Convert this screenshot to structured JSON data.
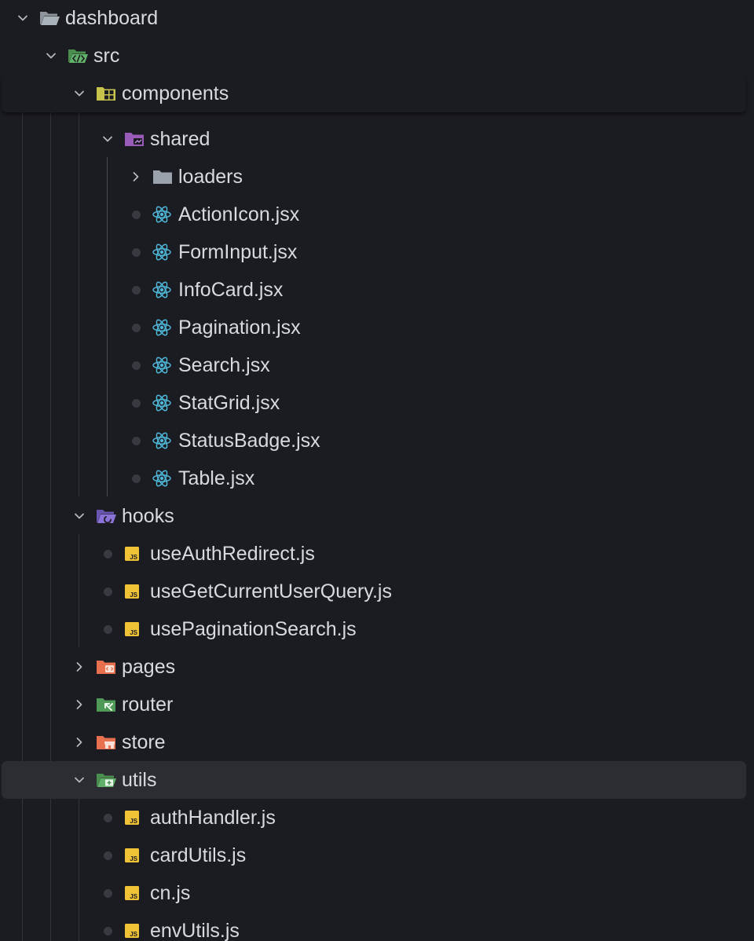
{
  "colors": {
    "background": "#1b1c21",
    "selected_row": "#2c2d33",
    "text": "#d9dade",
    "react_icon": "#4fb8d8",
    "js_icon": "#f0c236",
    "folder_default": "#9aa3ad"
  },
  "tree": {
    "root": {
      "label": "dashboard",
      "icon": "folder-open-icon",
      "expanded": true
    },
    "src": {
      "label": "src",
      "icon": "folder-src-icon",
      "expanded": true
    },
    "components": {
      "label": "components",
      "icon": "folder-components-icon",
      "expanded": true
    },
    "shared": {
      "label": "shared",
      "icon": "folder-shared-icon",
      "expanded": true
    },
    "loaders": {
      "label": "loaders",
      "icon": "folder-icon",
      "expanded": false
    },
    "shared_files": [
      {
        "label": "ActionIcon.jsx",
        "icon": "react-icon"
      },
      {
        "label": "FormInput.jsx",
        "icon": "react-icon"
      },
      {
        "label": "InfoCard.jsx",
        "icon": "react-icon"
      },
      {
        "label": "Pagination.jsx",
        "icon": "react-icon"
      },
      {
        "label": "Search.jsx",
        "icon": "react-icon"
      },
      {
        "label": "StatGrid.jsx",
        "icon": "react-icon"
      },
      {
        "label": "StatusBadge.jsx",
        "icon": "react-icon"
      },
      {
        "label": "Table.jsx",
        "icon": "react-icon"
      }
    ],
    "hooks": {
      "label": "hooks",
      "icon": "folder-hooks-icon",
      "expanded": true
    },
    "hooks_files": [
      {
        "label": "useAuthRedirect.js",
        "icon": "js-icon"
      },
      {
        "label": "useGetCurrentUserQuery.js",
        "icon": "js-icon"
      },
      {
        "label": "usePaginationSearch.js",
        "icon": "js-icon"
      }
    ],
    "pages": {
      "label": "pages",
      "icon": "folder-pages-icon",
      "expanded": false
    },
    "router": {
      "label": "router",
      "icon": "folder-router-icon",
      "expanded": false
    },
    "store": {
      "label": "store",
      "icon": "folder-store-icon",
      "expanded": false
    },
    "utils": {
      "label": "utils",
      "icon": "folder-utils-icon",
      "expanded": true,
      "selected": true
    },
    "utils_files": [
      {
        "label": "authHandler.js",
        "icon": "js-icon"
      },
      {
        "label": "cardUtils.js",
        "icon": "js-icon"
      },
      {
        "label": "cn.js",
        "icon": "js-icon"
      },
      {
        "label": "envUtils.js",
        "icon": "js-icon"
      }
    ]
  }
}
